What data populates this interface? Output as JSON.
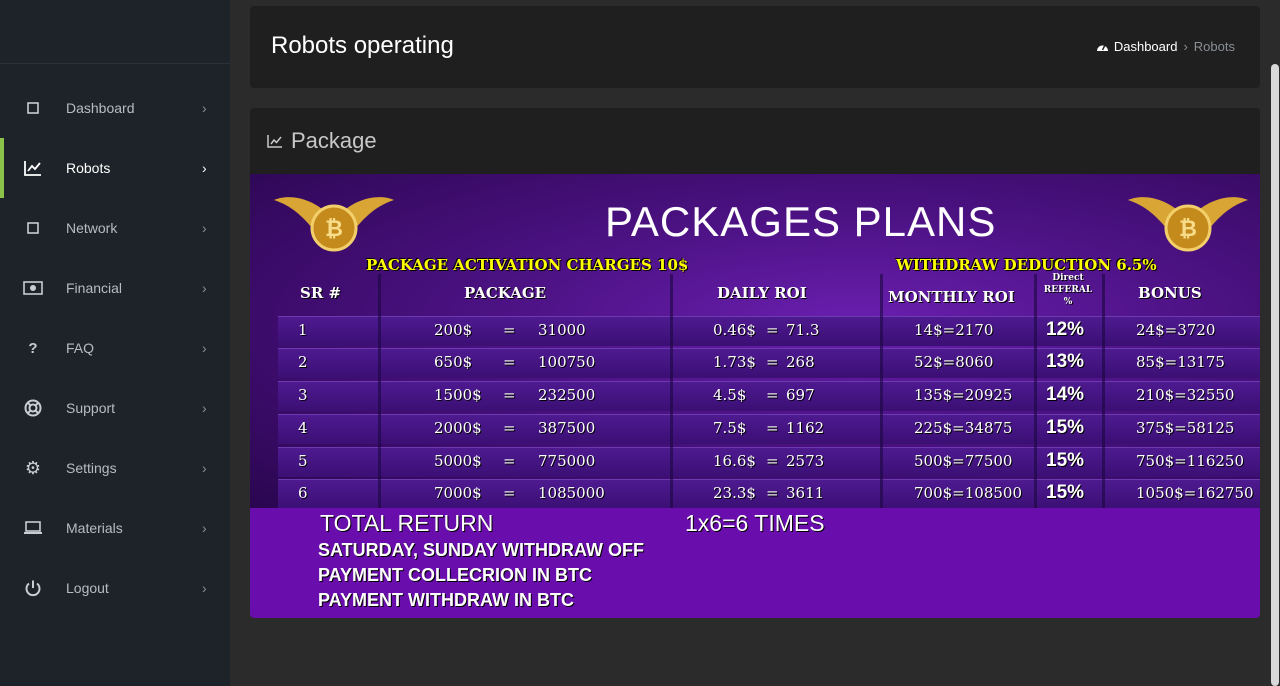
{
  "sidebar": {
    "items": [
      {
        "label": "Dashboard",
        "icon": "square-icon"
      },
      {
        "label": "Robots",
        "icon": "chart-line-icon",
        "active": true
      },
      {
        "label": "Network",
        "icon": "square-icon"
      },
      {
        "label": "Financial",
        "icon": "money-icon"
      },
      {
        "label": "FAQ",
        "icon": "question-icon"
      },
      {
        "label": "Support",
        "icon": "lifebuoy-icon"
      },
      {
        "label": "Settings",
        "icon": "gear-icon"
      },
      {
        "label": "Materials",
        "icon": "laptop-icon"
      },
      {
        "label": "Logout",
        "icon": "power-icon"
      }
    ],
    "accent_color": "#8bc34a"
  },
  "header": {
    "title": "Robots operating",
    "breadcrumb": {
      "home": "Dashboard",
      "separator": "›",
      "current": "Robots"
    }
  },
  "card": {
    "title": "Package"
  },
  "plan": {
    "title": "PACKAGES PLANS",
    "activation": "PACKAGE ACTIVATION CHARGES 10$",
    "withdraw_deduction": "WITHDRAW DEDUCTION 6.5%",
    "headers": {
      "sr": "SR #",
      "package": "PACKAGE",
      "daily": "DAILY ROI",
      "monthly": "MONTHLY ROI",
      "referral_1": "Direct",
      "referral_2": "REFERAL",
      "referral_3": "%",
      "bonus": "BONUS"
    },
    "rows": [
      {
        "sr": "1",
        "usd": "200$",
        "eq": "=",
        "amount": "31000",
        "daily_usd": "0.46$",
        "daily_eq": "=",
        "daily_amount": "71.3",
        "monthly": "14$=2170",
        "referral": "12%",
        "bonus": "24$=3720"
      },
      {
        "sr": "2",
        "usd": "650$",
        "eq": "=",
        "amount": "100750",
        "daily_usd": "1.73$",
        "daily_eq": "=",
        "daily_amount": "268",
        "monthly": "52$=8060",
        "referral": "13%",
        "bonus": "85$=13175"
      },
      {
        "sr": "3",
        "usd": "1500$",
        "eq": "=",
        "amount": "232500",
        "daily_usd": "4.5$",
        "daily_eq": "=",
        "daily_amount": "697",
        "monthly": "135$=20925",
        "referral": "14%",
        "bonus": "210$=32550"
      },
      {
        "sr": "4",
        "usd": "2000$",
        "eq": "=",
        "amount": "387500",
        "daily_usd": "7.5$",
        "daily_eq": "=",
        "daily_amount": "1162",
        "monthly": "225$=34875",
        "referral": "15%",
        "bonus": "375$=58125"
      },
      {
        "sr": "5",
        "usd": "5000$",
        "eq": "=",
        "amount": "775000",
        "daily_usd": "16.6$",
        "daily_eq": "=",
        "daily_amount": "2573",
        "monthly": "500$=77500",
        "referral": "15%",
        "bonus": "750$=116250"
      },
      {
        "sr": "6",
        "usd": "7000$",
        "eq": "=",
        "amount": "1085000",
        "daily_usd": "23.3$",
        "daily_eq": "=",
        "daily_amount": "3611",
        "monthly": "700$=108500",
        "referral": "15%",
        "bonus": "1050$=162750"
      }
    ],
    "total_return_label": "TOTAL RETURN",
    "total_return_value": "1x6=6 TIMES",
    "notes": [
      "SATURDAY, SUNDAY WITHDRAW OFF",
      "PAYMENT COLLECRION IN BTC",
      "PAYMENT WITHDRAW IN BTC"
    ]
  }
}
